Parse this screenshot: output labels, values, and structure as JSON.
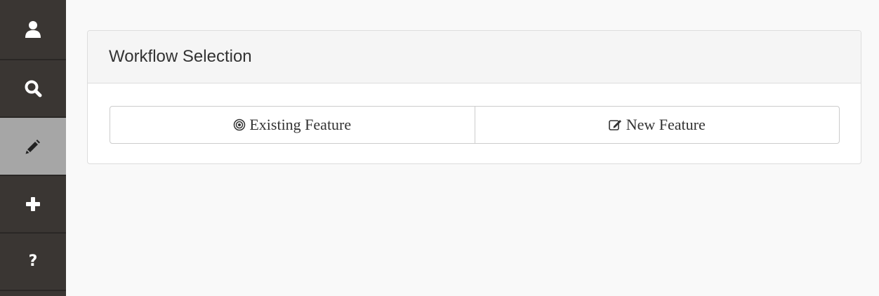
{
  "sidebar": {
    "background": "#3a3633",
    "active_background": "#a6a6a6",
    "items": [
      {
        "name": "user",
        "icon": "user-icon",
        "label": "",
        "active": false
      },
      {
        "name": "search",
        "icon": "search-icon",
        "label": "",
        "active": false
      },
      {
        "name": "edit",
        "icon": "pencil-icon",
        "label": "",
        "active": true
      },
      {
        "name": "add",
        "icon": "plus-icon",
        "label": "",
        "active": false
      },
      {
        "name": "help",
        "icon": "question-icon",
        "label": "?",
        "active": false
      }
    ]
  },
  "panel": {
    "title": "Workflow Selection",
    "buttons": [
      {
        "label": "Existing Feature",
        "icon": "target-icon"
      },
      {
        "label": "New Feature",
        "icon": "edit-square-icon"
      }
    ]
  }
}
